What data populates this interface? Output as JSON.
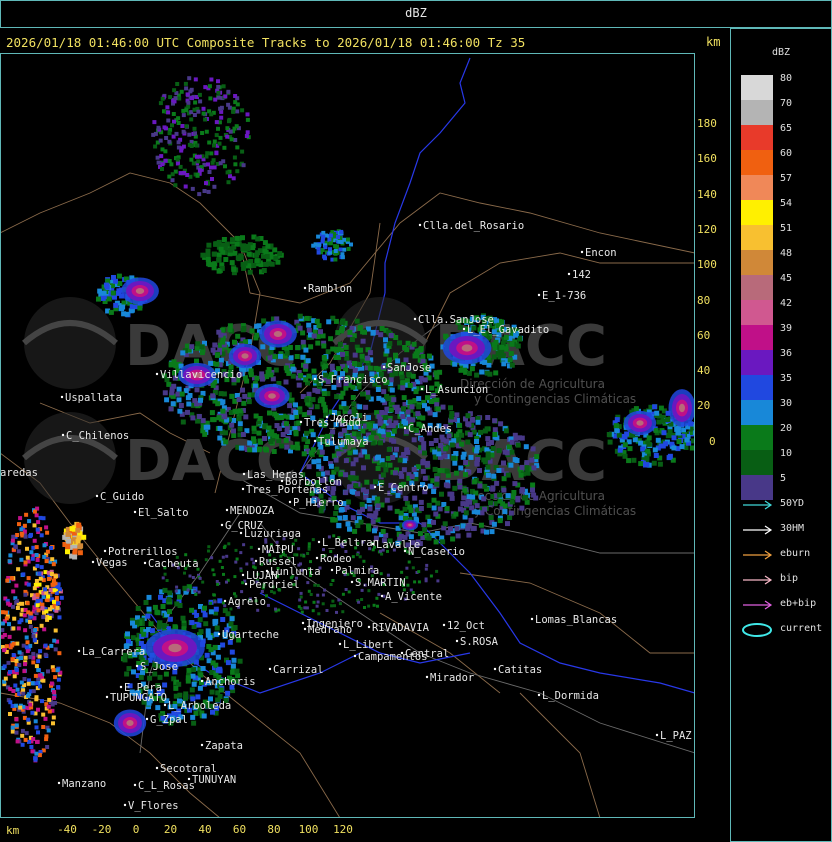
{
  "header": {
    "product": "dBZ"
  },
  "title": "2026/01/18 01:46:00 UTC Composite Tracks to 2026/01/18 01:46:00 Tz 35",
  "units": {
    "top": "km",
    "bottom": "km"
  },
  "legend": {
    "title": "dBZ",
    "bins": [
      {
        "label": "80",
        "color": "#d8d8d8"
      },
      {
        "label": "70",
        "color": "#b4b4b4"
      },
      {
        "label": "65",
        "color": "#e83a2a"
      },
      {
        "label": "60",
        "color": "#f06010"
      },
      {
        "label": "57",
        "color": "#f08858"
      },
      {
        "label": "54",
        "color": "#fff000"
      },
      {
        "label": "51",
        "color": "#f8c030"
      },
      {
        "label": "48",
        "color": "#d08838"
      },
      {
        "label": "45",
        "color": "#b86a7a"
      },
      {
        "label": "42",
        "color": "#d05890"
      },
      {
        "label": "39",
        "color": "#c01088"
      },
      {
        "label": "36",
        "color": "#6a18c0"
      },
      {
        "label": "35",
        "color": "#2048e0"
      },
      {
        "label": "30",
        "color": "#1888d8"
      },
      {
        "label": "20",
        "color": "#0a7a1a"
      },
      {
        "label": "10",
        "color": "#085e14"
      },
      {
        "label": "5",
        "color": "#483888"
      }
    ],
    "tracks": [
      {
        "label": "50YD",
        "color": "#40d8d8"
      },
      {
        "label": "30HM",
        "color": "#ffffff"
      },
      {
        "label": "eburn",
        "color": "#f0a040"
      },
      {
        "label": "bip",
        "color": "#f8b8c8"
      },
      {
        "label": "eb+bip",
        "color": "#e060e0"
      },
      {
        "label": "current",
        "color": "#40e8e8"
      }
    ]
  },
  "axes": {
    "y_ticks": [
      "180",
      "160",
      "140",
      "120",
      "100",
      "80",
      "60",
      "40",
      "20",
      "0"
    ],
    "x_ticks": [
      "-40",
      "-20",
      "0",
      "20",
      "40",
      "60",
      "80",
      "100",
      "120"
    ]
  },
  "places": [
    {
      "name": "Clla.del_Rosario"
    },
    {
      "name": "Encon"
    },
    {
      "name": "142"
    },
    {
      "name": "E_1-736"
    },
    {
      "name": "Ramblon"
    },
    {
      "name": "Clla.SanJose"
    },
    {
      "name": "L_El_Gavadito"
    },
    {
      "name": "S_Francisco"
    },
    {
      "name": "SanJose"
    },
    {
      "name": "L_Asuncion"
    },
    {
      "name": "Uspallata"
    },
    {
      "name": "C_Chilenos"
    },
    {
      "name": "aredas"
    },
    {
      "name": "Tulumaya"
    },
    {
      "name": "Tres_Maud"
    },
    {
      "name": "C_Andes"
    },
    {
      "name": "Borbollon"
    },
    {
      "name": "E_Centro"
    },
    {
      "name": "Las_Heras"
    },
    {
      "name": "P_Hierro"
    },
    {
      "name": "C_Guido"
    },
    {
      "name": "El_Salto"
    },
    {
      "name": "MENDOZA"
    },
    {
      "name": "G_CRUZ"
    },
    {
      "name": "Luzuriaga"
    },
    {
      "name": "MAIPU"
    },
    {
      "name": "Russel"
    },
    {
      "name": "LUJAN"
    },
    {
      "name": "Lunlunta"
    },
    {
      "name": "Potrerillos"
    },
    {
      "name": "Cacheuta"
    },
    {
      "name": "Vegas"
    },
    {
      "name": "Perdriel"
    },
    {
      "name": "L_Beltran"
    },
    {
      "name": "Palmira"
    },
    {
      "name": "Rodeo"
    },
    {
      "name": "N_Caserio"
    },
    {
      "name": "S.MARTIN"
    },
    {
      "name": "Agrelo"
    },
    {
      "name": "A_Vicente"
    },
    {
      "name": "Ugarteche"
    },
    {
      "name": "La_Carrera"
    },
    {
      "name": "S_Jose"
    },
    {
      "name": "Anchoris"
    },
    {
      "name": "E_Pera"
    },
    {
      "name": "TUPUNGATO"
    },
    {
      "name": "L_Arboleda"
    },
    {
      "name": "Carrizal"
    },
    {
      "name": "Medrano"
    },
    {
      "name": "RIVADAVIA"
    },
    {
      "name": "L_Libert"
    },
    {
      "name": "Campamentos"
    },
    {
      "name": "Central"
    },
    {
      "name": "12_Oct"
    },
    {
      "name": "S.ROSA"
    },
    {
      "name": "Lomas_Blancas"
    },
    {
      "name": "Catitas"
    },
    {
      "name": "Mirador"
    },
    {
      "name": "L_Dormida"
    },
    {
      "name": "L_PAZ"
    },
    {
      "name": "G_Zpal"
    },
    {
      "name": "Zapata"
    },
    {
      "name": "Secotoral"
    },
    {
      "name": "TUNUYAN"
    },
    {
      "name": "Manzano"
    },
    {
      "name": "C_L_Rosas"
    },
    {
      "name": "V_Flores"
    },
    {
      "name": "Villavicencio"
    },
    {
      "name": "Jocoli"
    },
    {
      "name": "Lavalle"
    },
    {
      "name": "Ingeniero"
    },
    {
      "name": "Tres_Porteñas"
    }
  ],
  "watermark": {
    "brand": "DACC",
    "line1": "Dirección de Agricultura",
    "line2": "y Contingencias Climáticas"
  }
}
